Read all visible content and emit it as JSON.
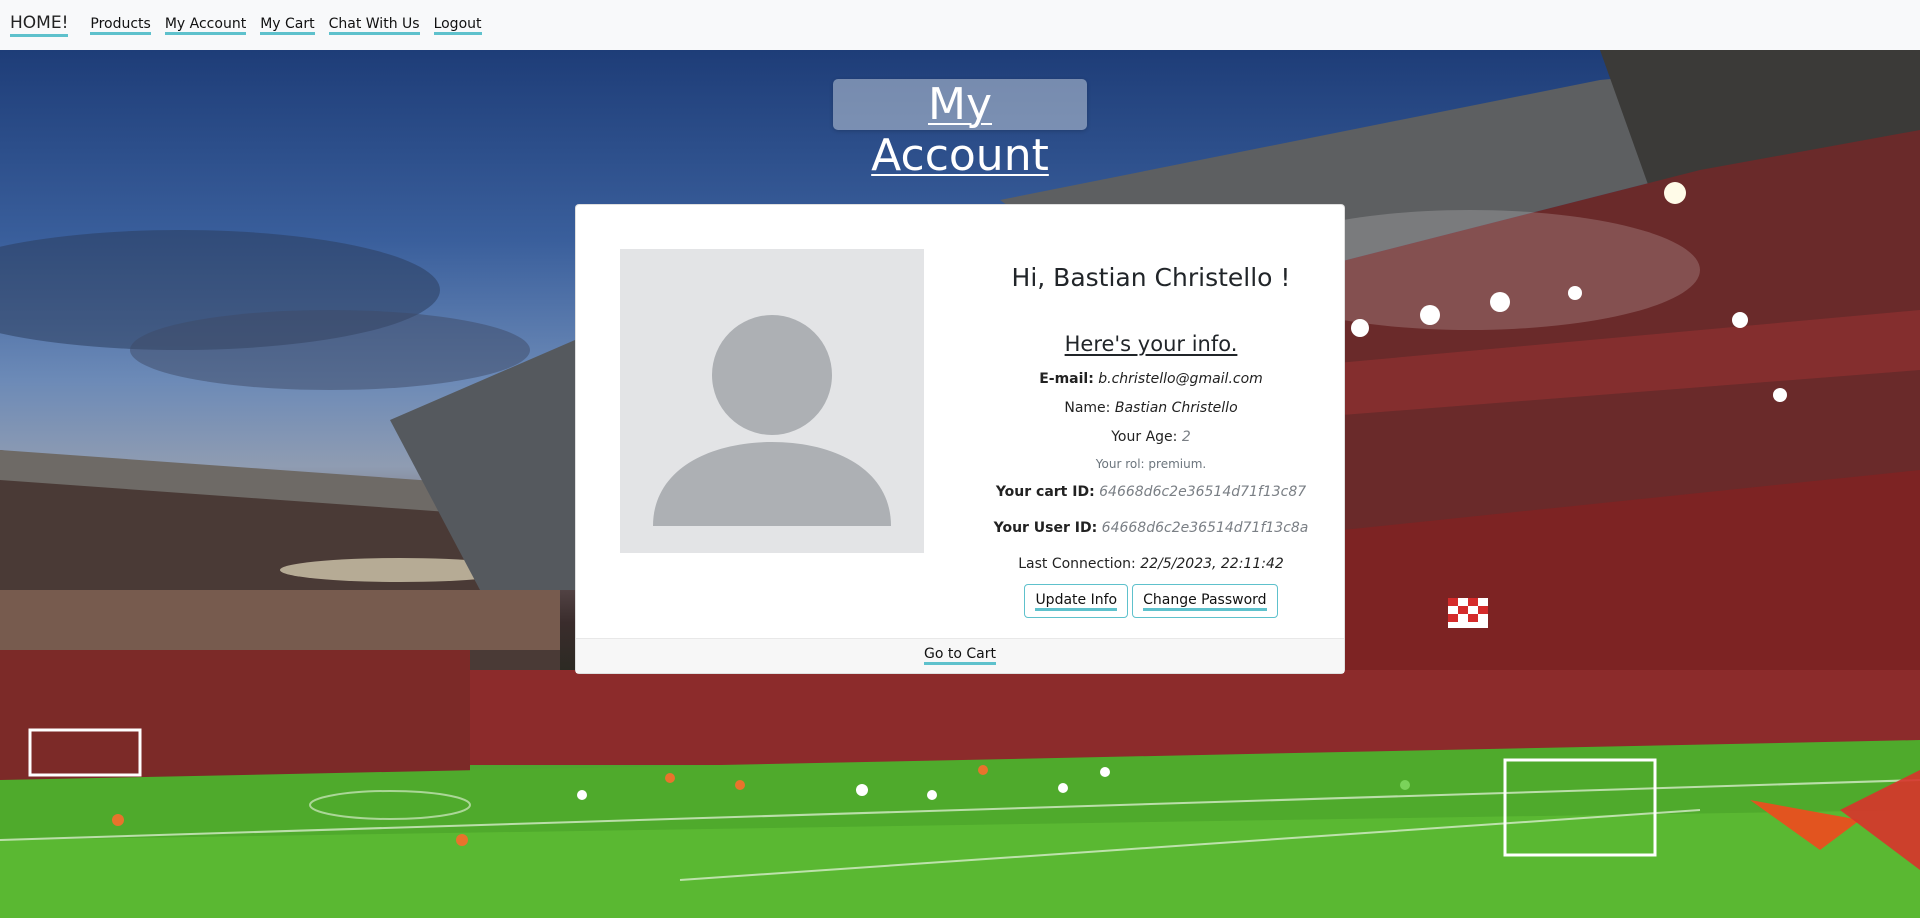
{
  "navbar": {
    "brand": "HOME!",
    "links": [
      "Products",
      "My Account",
      "My Cart",
      "Chat With Us",
      "Logout"
    ]
  },
  "page": {
    "title": "My Account"
  },
  "profile": {
    "greeting": "Hi, Bastian Christello !",
    "subheading": "Here's your info.",
    "email_label": "E-mail:",
    "email_value": "b.christello@gmail.com",
    "name_label": "Name:",
    "name_value": "Bastian Christello",
    "age_label": "Your Age:",
    "age_value": "2",
    "rol_text": "Your rol: premium.",
    "cart_id_label": "Your cart ID:",
    "cart_id_value": "64668d6c2e36514d71f13c87",
    "user_id_label": "Your User ID:",
    "user_id_value": "64668d6c2e36514d71f13c8a",
    "last_connection_label": "Last Connection:",
    "last_connection_value": "22/5/2023, 22:11:42"
  },
  "buttons": {
    "update_info": "Update Info",
    "change_password": "Change Password"
  },
  "footer": {
    "go_to_cart": "Go to Cart"
  },
  "colors": {
    "accent": "#5ec1cc",
    "navbar_bg": "#f8f9fa",
    "avatar_bg": "#e3e4e6",
    "avatar_fg": "#adb0b4"
  },
  "icons": {
    "avatar": "user-silhouette-icon"
  }
}
